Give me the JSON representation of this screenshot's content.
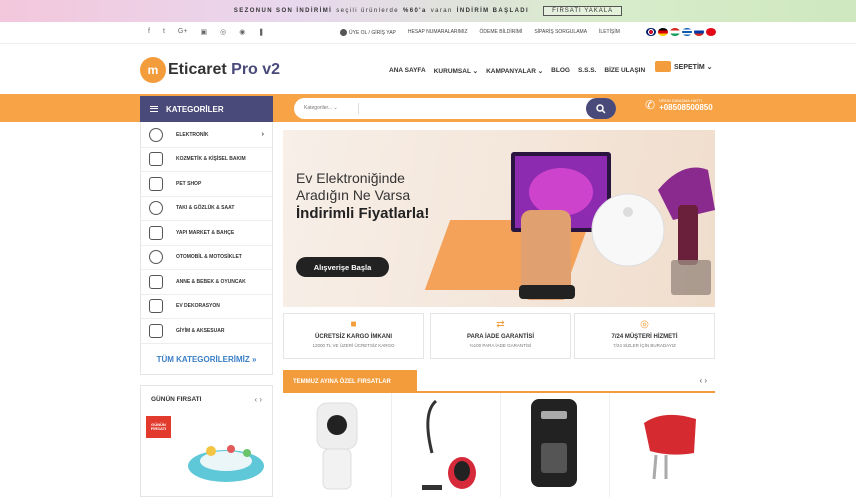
{
  "promo": {
    "part1": "SEZONUN SON İNDİRİMİ",
    "part2": "seçili ürünlerde",
    "part3": "%60'a",
    "part4": "varan",
    "part5": "İNDİRİM BAŞLADI",
    "button": "FIRSATI YAKALA"
  },
  "social": [
    "f",
    "t",
    "G+",
    "▣",
    "◎",
    "◉",
    "❚"
  ],
  "toplinks": {
    "login": "ÜYE OL / GİRİŞ YAP",
    "accounts": "HESAP NUMARALARIMIZ",
    "payment": "ÖDEME BİLDİRİMİ",
    "order": "SİPARİŞ SORGULAMA",
    "contact": "İLETİŞİM"
  },
  "logo": {
    "badge": "m",
    "text_main": "Eticaret",
    "text_accent": "Pro v2"
  },
  "nav": [
    "ANA SAYFA",
    "KURUMSAL ⌄",
    "KAMPANYALAR ⌄",
    "BLOG",
    "S.S.S.",
    "BİZE ULAŞIN"
  ],
  "cart": {
    "label": "SEPETİM ⌄"
  },
  "categories_head": "KATEGORİLER",
  "search": {
    "category": "Kategoriler... ⌄",
    "placeholder": ""
  },
  "hotline": {
    "label": "ÜRÜN DANIŞMA HATTI",
    "number": "+08508500850"
  },
  "categories": [
    "ELEKTRONİK",
    "KOZMETİK & KİŞİSEL BAKIM",
    "PET SHOP",
    "TAKI & GÖZLÜK & SAAT",
    "YAPI MARKET & BAHÇE",
    "OTOMOBİL & MOTOSİKLET",
    "ANNE & BEBEK & OYUNCAK",
    "EV DEKORASYON",
    "GİYİM & AKSESUAR"
  ],
  "all_categories": "TÜM KATEGORİLERİMİZ »",
  "banner": {
    "line1": "Ev Elektroniğinde",
    "line2": "Aradığın Ne Varsa",
    "line3": "İndirimli Fiyatlarla!",
    "button": "Alışverişe Başla"
  },
  "features": [
    {
      "title": "ÜCRETSİZ KARGO İMKANI",
      "sub": "12000 TL VE ÜZERİ ÜCRETSİZ KARGO"
    },
    {
      "title": "PARA İADE GARANTİSİ",
      "sub": "%100 PARA İADE GARANTİSİ"
    },
    {
      "title": "7/24 MÜŞTERİ HİZMETİ",
      "sub": "7/24 SİZLER İÇİN BURADAYIZ"
    }
  ],
  "deals": {
    "title": "TEMMUZ AYINA ÖZEL FIRSATLAR",
    "nav": "‹  ›"
  },
  "daily": {
    "title": "GÜNÜN FIRSATI",
    "nav": "‹  ›",
    "badge": "GÜNÜN FIRSATI"
  },
  "colors": {
    "accent": "#f39c3c",
    "navy": "#4a4a7a"
  }
}
